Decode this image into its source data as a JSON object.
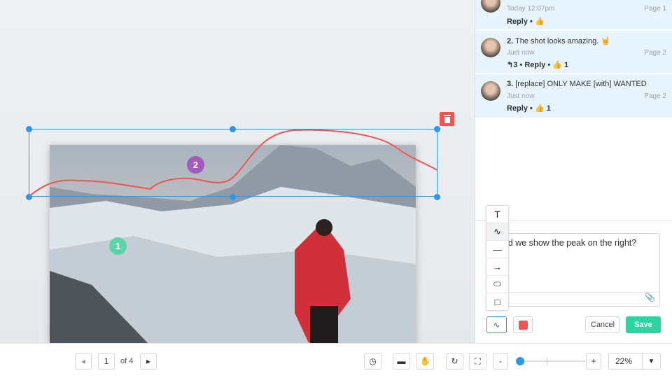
{
  "canvas": {
    "markers": [
      "1",
      "2"
    ],
    "marker_colors": {
      "1": "#5fd3a8",
      "2": "#a35bbd"
    },
    "annotation_color": "#f0564f",
    "selection_color": "#2f95e6"
  },
  "comments": [
    {
      "number": "",
      "text": "",
      "time": "Today 12:07pm",
      "page": "Page 1",
      "replies": "",
      "reply_label": "Reply",
      "likes": ""
    },
    {
      "number": "2.",
      "text": "The shot looks amazing. 🤘",
      "time": "Just now",
      "page": "Page 2",
      "replies": "3",
      "reply_label": "Reply",
      "likes": "1"
    },
    {
      "number": "3.",
      "text": "[replace] ONLY MAKE [with] WANTED",
      "time": "Just now",
      "page": "Page 2",
      "replies": "",
      "reply_label": "Reply",
      "likes": "1"
    }
  ],
  "editor": {
    "text": "ld we show the peak on the right?",
    "tools": [
      "T",
      "freehand",
      "line",
      "arrow",
      "ellipse",
      "rectangle"
    ],
    "cancel_label": "Cancel",
    "save_label": "Save",
    "color": "#f0564f"
  },
  "toolbar": {
    "page": "1",
    "of_label": "of 4",
    "zoom": "22%",
    "zoom_fraction": 0.05,
    "minus": "-",
    "plus": "+"
  }
}
